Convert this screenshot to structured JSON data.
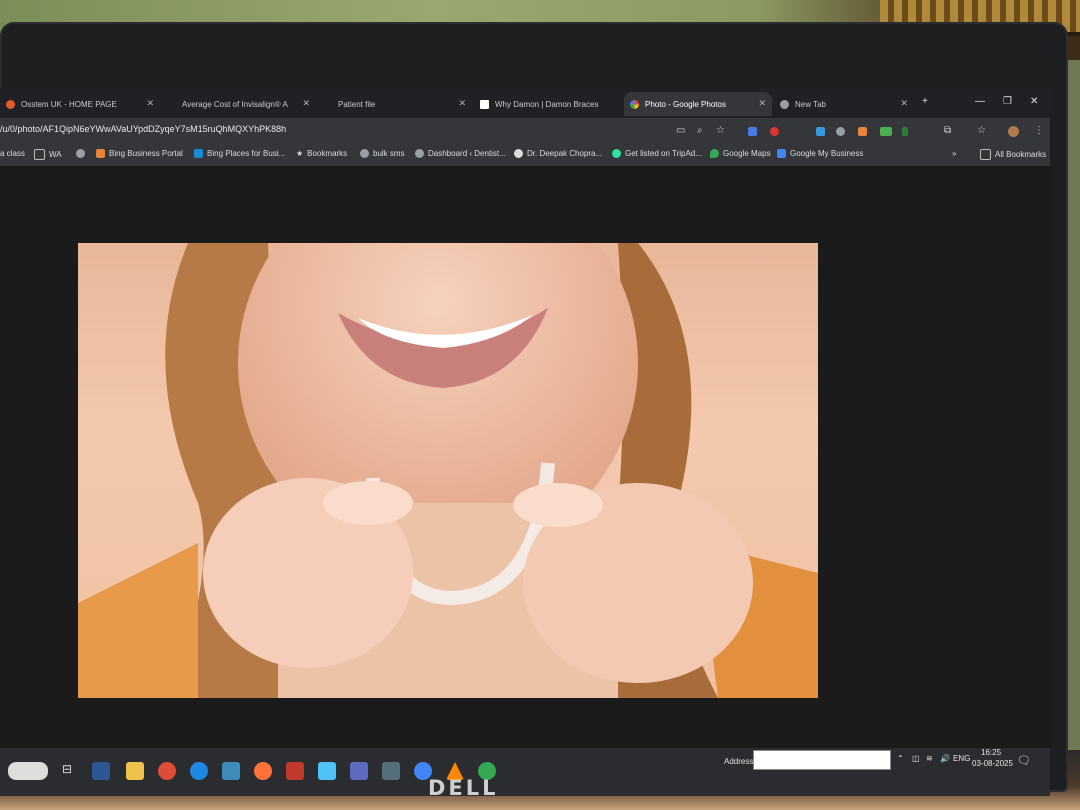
{
  "tabs": [
    {
      "title": "Osstem UK - HOME PAGE",
      "favicon": "orange"
    },
    {
      "title": "Average Cost of Invisalign® A",
      "favicon": "none"
    },
    {
      "title": "Patient file",
      "favicon": "none"
    },
    {
      "title": "Why Damon | Damon Braces",
      "favicon": "damon-d"
    },
    {
      "title": "Photo - Google Photos",
      "favicon": "google-photos"
    },
    {
      "title": "New Tab",
      "favicon": "chrome"
    }
  ],
  "address_bar": {
    "url": "/u/0/photo/AF1QipN6eYWwAVaUYpdDZyqeY7sM15ruQhMQXYhPK88h"
  },
  "bookmarks": [
    {
      "label": "a class"
    },
    {
      "label": "WA"
    },
    {
      "label": ""
    },
    {
      "label": "Bing Business Portal"
    },
    {
      "label": "Bing Places for Busi..."
    },
    {
      "label": "Bookmarks"
    },
    {
      "label": "bulk sms"
    },
    {
      "label": "Dashboard ‹ Dentist..."
    },
    {
      "label": "Dr. Deepak Chopra..."
    },
    {
      "label": "Get listed on TripAd..."
    },
    {
      "label": "Google Maps"
    },
    {
      "label": "Google My Business"
    }
  ],
  "all_bookmarks": "All Bookmarks",
  "taskbar": {
    "address_label": "Address",
    "language": "ENG",
    "time": "16:25",
    "date": "03-08-2025"
  },
  "monitor_brand": "DELL",
  "colors": {
    "accent": "#35363a",
    "background": "#202124"
  }
}
